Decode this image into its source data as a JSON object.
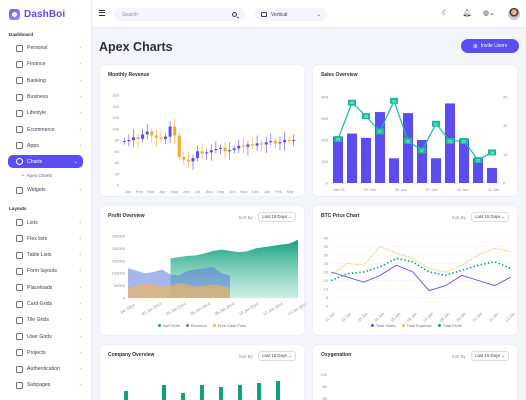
{
  "brand": {
    "name": "DashBoi"
  },
  "sidebar": {
    "section1": "Dashboard",
    "items": [
      {
        "label": "Personal",
        "icon": "user-icon"
      },
      {
        "label": "Finance",
        "icon": "dollar-icon"
      },
      {
        "label": "Banking",
        "icon": "bank-icon"
      },
      {
        "label": "Business",
        "icon": "briefcase-icon"
      },
      {
        "label": "Lifestyle",
        "icon": "heart-icon"
      },
      {
        "label": "Ecommerce",
        "icon": "cart-icon"
      },
      {
        "label": "Apps",
        "icon": "grid-icon"
      },
      {
        "label": "Charts",
        "icon": "pie-chart-icon",
        "active": true
      },
      {
        "label": "Apex Charts",
        "sub": true
      },
      {
        "label": "Widgets",
        "icon": "widget-icon"
      }
    ],
    "section2": "Layouts",
    "items2": [
      {
        "label": "Lists"
      },
      {
        "label": "Flex lists"
      },
      {
        "label": "Table Lists"
      },
      {
        "label": "Form layouts"
      },
      {
        "label": "Placeloads"
      },
      {
        "label": "Card Grids"
      },
      {
        "label": "Tile Grids"
      },
      {
        "label": "User Grids"
      },
      {
        "label": "Projects"
      },
      {
        "label": "Authentication"
      },
      {
        "label": "Subpages"
      }
    ]
  },
  "header": {
    "search_placeholder": "Search",
    "layout_value": "Vertical"
  },
  "page": {
    "title": "Apex Charts",
    "invite_label": "Invite Users"
  },
  "cards": {
    "monthly_revenue": "Monthly Revenue",
    "sales_overview": "Sales Overview",
    "profit_overview": "Profit Overview",
    "btc_price": "BTC Price Chart",
    "company_overview": "Company Overview",
    "oxygenation": "Oxygenation",
    "sort_label": "Sort By :",
    "sort_value": "Last 15 Days"
  },
  "chart_data": [
    {
      "type": "candlestick",
      "title": "Monthly Revenue",
      "categories": [
        "Jan",
        "Feb",
        "Mar",
        "Apr",
        "May",
        "Jun",
        "Jul",
        "Aug",
        "Sep",
        "Oct",
        "Nov",
        "Dec",
        "Jan",
        "Feb",
        "Mar"
      ],
      "y_ticks": [
        160,
        140,
        120,
        100,
        80,
        60,
        40,
        20,
        0
      ],
      "ylim": [
        0,
        160
      ],
      "colors": {
        "up": "#5b4df0",
        "down": "#f9a825"
      }
    },
    {
      "type": "bar+line",
      "title": "Sales Overview",
      "categories": [
        "Jan 01",
        "03 Jan",
        "05 Jan",
        "07 Jan",
        "09 Jan",
        "11 Jan"
      ],
      "bars": [
        430,
        460,
        420,
        660,
        230,
        650,
        400,
        230,
        740,
        410,
        230,
        140
      ],
      "line": [
        23,
        42,
        35,
        27,
        43,
        22,
        17,
        31,
        22,
        22,
        12,
        16
      ],
      "left_ticks": [
        800,
        600,
        400,
        200,
        0
      ],
      "right_ticks": [
        45,
        30,
        15,
        0
      ],
      "colors": {
        "bar": "#5b4df0",
        "line": "#1abc9c"
      }
    },
    {
      "type": "area",
      "title": "Profit Overview",
      "x": [
        "Jan 2014",
        "02 Jan 2014",
        "04 Jan 2014",
        "06 Jan 2014",
        "08 Jan 2014",
        "10 Jan 2014",
        "12 Jan 2014",
        "14 Jan 2014"
      ],
      "y_ticks": [
        250000,
        200000,
        150000,
        100000,
        50000,
        0
      ],
      "legend": [
        "Net Profit",
        "Revenue",
        "Free Cash Flow"
      ],
      "colors": [
        "#12a17e",
        "#5b7ad8",
        "#f6b84b"
      ]
    },
    {
      "type": "line",
      "title": "BTC Price Chart",
      "x": [
        "01 Jan",
        "02 Jan",
        "03 Jan",
        "04 Jan",
        "05 Jan",
        "06 Jan",
        "07 Jan",
        "08 Jan",
        "09 Jan",
        "10 Jan",
        "11 Jan",
        "12 Jan"
      ],
      "y_ticks": [
        40,
        35,
        30,
        25,
        20,
        15,
        10,
        5,
        0
      ],
      "series": [
        {
          "name": "Total Sales",
          "values": [
            20,
            17,
            14,
            18,
            24,
            20,
            9,
            12,
            18,
            15,
            12,
            17
          ],
          "color": "#5b4df0"
        },
        {
          "name": "Total Expense",
          "values": [
            18,
            25,
            24,
            35,
            31,
            28,
            22,
            20,
            24,
            30,
            34,
            32
          ],
          "color": "#f6b84b"
        },
        {
          "name": "Total Profit",
          "values": [
            15,
            19,
            20,
            23,
            28,
            26,
            20,
            18,
            21,
            24,
            26,
            22
          ],
          "color": "#12a17e"
        }
      ]
    },
    {
      "type": "bar",
      "title": "Company Overview"
    },
    {
      "type": "area",
      "title": "Oxygenation",
      "y_ticks": [
        100,
        80,
        60
      ]
    }
  ]
}
